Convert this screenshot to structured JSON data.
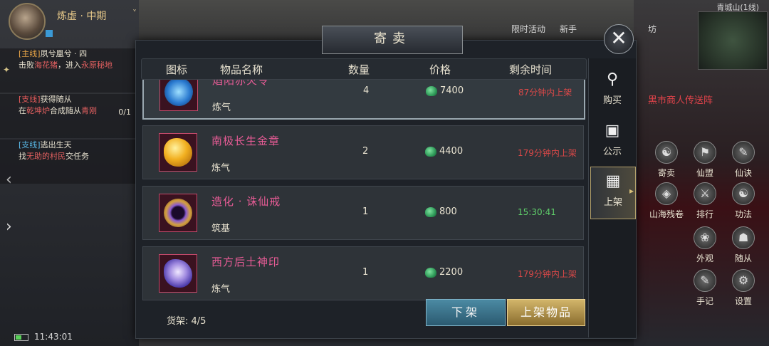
{
  "player": {
    "name": "炼虚 · 中期"
  },
  "quests": [
    {
      "tag": "[主线]",
      "text_a": "夙兮凰兮 · 四",
      "text_b": "击败",
      "highlight": "海花猪",
      "text_c": "，进入",
      "highlight2": "永原秘地",
      "count": ""
    },
    {
      "tag": "[支线]",
      "text_a": "获得随从",
      "text_b": "在",
      "highlight": "乾坤炉",
      "text_c": "合成随从",
      "highlight2": "青刚",
      "count": "0/1"
    },
    {
      "tag": "[支线]",
      "text_a": "逃出生天",
      "text_b": "找",
      "highlight": "无助的村民",
      "text_c": "交任务",
      "highlight2": "",
      "count": ""
    }
  ],
  "hud": {
    "server": "青城山(1线)",
    "clock": "11:43:01",
    "event_label": "黑市商人传送阵",
    "top_tabs": [
      "限时活动",
      "新手",
      "坊"
    ],
    "side_buttons": [
      {
        "label": "寄卖",
        "icon": "☯"
      },
      {
        "label": "仙盟",
        "icon": "⚑"
      },
      {
        "label": "仙诀",
        "icon": "✎"
      },
      {
        "label": "山海残卷",
        "icon": "◈"
      },
      {
        "label": "排行",
        "icon": "⚔"
      },
      {
        "label": "功法",
        "icon": "☯"
      },
      {
        "label": "外观",
        "icon": "❀"
      },
      {
        "label": "随从",
        "icon": "☗"
      },
      {
        "label": "手记",
        "icon": "✎"
      },
      {
        "label": "设置",
        "icon": "⚙"
      }
    ]
  },
  "modal": {
    "title": "寄卖",
    "close_symbol": "✕",
    "headers": {
      "icon": "图标",
      "name": "物品名称",
      "qty": "数量",
      "price": "价格",
      "time": "剩余时间"
    },
    "tabs": [
      {
        "label": "购买",
        "icon": "⚲"
      },
      {
        "label": "公示",
        "icon": "▣"
      },
      {
        "label": "上架",
        "icon": "▦"
      }
    ],
    "items": [
      {
        "name": "焰阳赤火令",
        "sub": "炼气",
        "qty": "4",
        "price": "7400",
        "time": "87分钟内上架",
        "time_color": "red",
        "gem": "blue"
      },
      {
        "name": "南极长生金章",
        "sub": "炼气",
        "qty": "2",
        "price": "4400",
        "time": "179分钟内上架",
        "time_color": "red",
        "gem": "gold"
      },
      {
        "name": "造化 · 诛仙戒",
        "sub": "筑基",
        "qty": "1",
        "price": "800",
        "time": "15:30:41",
        "time_color": "green",
        "gem": "purple"
      },
      {
        "name": "西方后土神印",
        "sub": "炼气",
        "qty": "1",
        "price": "2200",
        "time": "179分钟内上架",
        "time_color": "red",
        "gem": "violet"
      }
    ],
    "shelf_count": "货架: 4/5",
    "btn_unshelf": "下架",
    "btn_list": "上架物品"
  },
  "colors": {
    "item_name": "#e85c96",
    "time_red": "#d94848",
    "time_green": "#5fcf6a",
    "accent_gold": "#d2b56a"
  }
}
